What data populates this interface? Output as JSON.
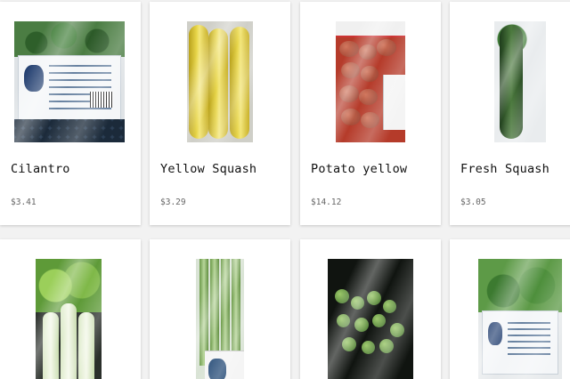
{
  "products": [
    {
      "name": "Cilantro",
      "price": "$3.41",
      "image_icon": "cilantro-bag-image"
    },
    {
      "name": "Yellow Squash",
      "price": "$3.29",
      "image_icon": "yellow-squash-image"
    },
    {
      "name": "Potato yellow",
      "price": "$14.12",
      "image_icon": "potato-bag-image"
    },
    {
      "name": "Fresh Squash",
      "price": "$3.05",
      "image_icon": "fresh-squash-image"
    },
    {
      "name": "",
      "price": "",
      "image_icon": "bok-choy-image"
    },
    {
      "name": "",
      "price": "",
      "image_icon": "leek-bundle-image"
    },
    {
      "name": "",
      "price": "",
      "image_icon": "brussels-sprouts-bag-image"
    },
    {
      "name": "",
      "price": "",
      "image_icon": "spinach-bag-image"
    }
  ]
}
